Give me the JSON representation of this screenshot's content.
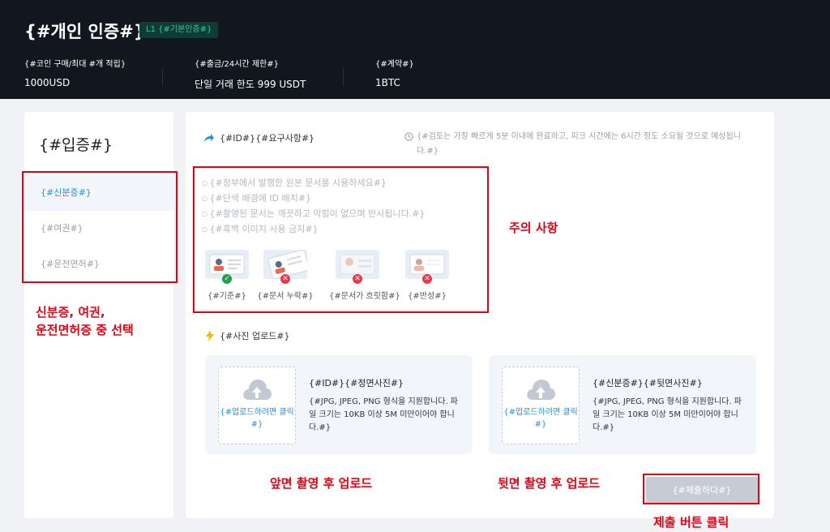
{
  "header": {
    "title": "{#개인 인증#}",
    "level_badge": "L1 {#기본인증#}",
    "stats": [
      {
        "label": "{#코인 구매/최대 #개 적립}",
        "value": "1000USD"
      },
      {
        "label": "{#출금/24시간 제한#}",
        "value": "단일 거래 한도 999 USDT"
      },
      {
        "label": "{#계약#}",
        "value": "1BTC"
      }
    ]
  },
  "sidebar": {
    "title": "{#입증#}",
    "items": [
      {
        "label": "{#신분증#}",
        "active": true
      },
      {
        "label": "{#여권#}",
        "active": false
      },
      {
        "label": "{#운전면허#}",
        "active": false
      }
    ]
  },
  "requirements": {
    "heading": "{#ID#}{#요구사항#}",
    "review_note": "{#검토는 가장 빠르게 5분 이내에 완료하고, 피크 시간에는 6시간 정도 소요될 것으로 예상됩니다.#}",
    "rules": [
      "{#정부에서 발행한 원본 문서를 사용하세요#}",
      "{#단색 배경에 ID 배치#}",
      "{#촬영된 문서는 깨끗하고 막힘이 없으며 반사됩니다.#}",
      "{#흑백 이미지 사용 금지#}"
    ],
    "examples": [
      {
        "caption": "{#기준#}",
        "status": "ok"
      },
      {
        "caption": "{#문서 누락#}",
        "status": "bad"
      },
      {
        "caption": "{#문서가 흐릿함#}",
        "status": "bad"
      },
      {
        "caption": "{#반성#}",
        "status": "bad"
      }
    ]
  },
  "upload": {
    "heading": "{#사진 업로드#}",
    "drop_text": "{#업로드하려면 클릭#}",
    "front": {
      "title": "{#ID#}{#정면사진#}",
      "desc": "{#JPG, JPEG, PNG 형식을 지원합니다. 파일 크기는 10KB 이상 5M 미만이어야 합니다.#}"
    },
    "back": {
      "title": "{#신분증#}{#뒷면사진#}",
      "desc": "{#JPG, JPEG, PNG 형식을 지원합니다. 파일 크기는 10KB 이상 5M 미만이어야 합니다.#}"
    }
  },
  "submit_label": "{#제출하다#}",
  "annotations": {
    "choose_doc": "신분증, 여권,\n운전면허증 중 선택",
    "notes": "주의 사항",
    "front_upload": "앞면 촬영 후 업로드",
    "back_upload": "뒷면 촬영 후 업로드",
    "submit_click": "제출 버튼 클릭"
  },
  "colors": {
    "header_bg": "#12161f",
    "accent": "#2b8fd6",
    "annotation_red": "#e60012",
    "ok_green": "#1aa34a",
    "error_red": "#e8394c"
  }
}
